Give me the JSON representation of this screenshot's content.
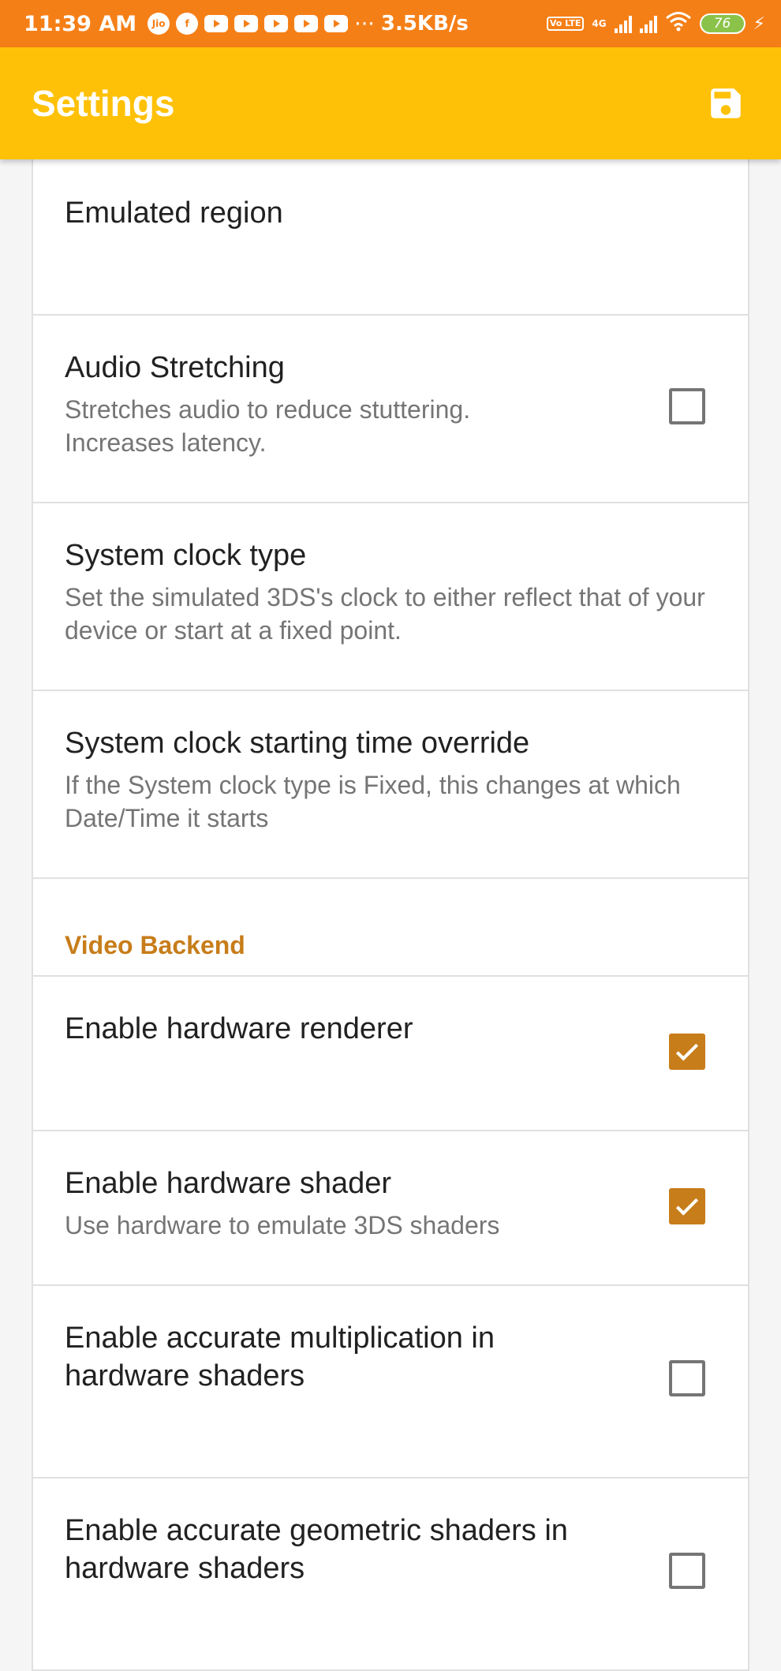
{
  "status_bar": {
    "time": "11:39 AM",
    "jio_label": "Jio",
    "speed": "3.5KB/s",
    "dots": "···",
    "volte_label": "Vo LTE",
    "network_label": "4G",
    "battery": "76",
    "bolt": "⚡"
  },
  "app_bar": {
    "title": "Settings",
    "save_icon": "save-icon"
  },
  "settings": {
    "emulated_region": {
      "title": "Emulated region"
    },
    "audio_stretching": {
      "title": "Audio Stretching",
      "summary": "Stretches audio to reduce stuttering. Increases latency.",
      "checked": false
    },
    "system_clock_type": {
      "title": "System clock type",
      "summary": "Set the simulated 3DS's clock to either reflect that of your device or start at a fixed point."
    },
    "clock_override": {
      "title": "System clock starting time override",
      "summary": "If the System clock type is Fixed, this changes at which Date/Time it starts"
    },
    "video_backend_header": "Video Backend",
    "hw_renderer": {
      "title": "Enable hardware renderer",
      "checked": true
    },
    "hw_shader": {
      "title": "Enable hardware shader",
      "summary": "Use hardware to emulate 3DS shaders",
      "checked": true
    },
    "accurate_mul": {
      "title": "Enable accurate multiplication in hardware shaders",
      "checked": false
    },
    "accurate_geo": {
      "title": "Enable accurate geometric shaders in hardware shaders",
      "checked": false
    }
  },
  "colors": {
    "status_bar": "#f57f17",
    "app_bar": "#ffc107",
    "accent": "#c77d1a"
  }
}
